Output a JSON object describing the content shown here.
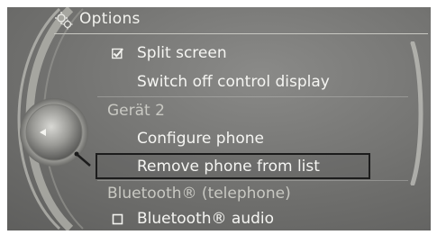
{
  "header": {
    "title": "Options",
    "icon": "options-icon"
  },
  "menu": {
    "items": [
      {
        "kind": "checkbox",
        "label": "Split screen",
        "checked": true
      },
      {
        "kind": "item",
        "label": "Switch off control display"
      },
      {
        "kind": "section",
        "label": "Gerät 2"
      },
      {
        "kind": "item",
        "label": "Configure phone"
      },
      {
        "kind": "item",
        "label": "Remove phone from list",
        "selected": true
      },
      {
        "kind": "section",
        "label": "Bluetooth® (telephone)"
      },
      {
        "kind": "checkbox",
        "label": "Bluetooth® audio",
        "checked": false
      }
    ]
  },
  "colors": {
    "background": "#6e6e6c",
    "text": "#f5f5f2",
    "section_text": "#c9c9c3",
    "selection_border": "#1c1c1c"
  }
}
